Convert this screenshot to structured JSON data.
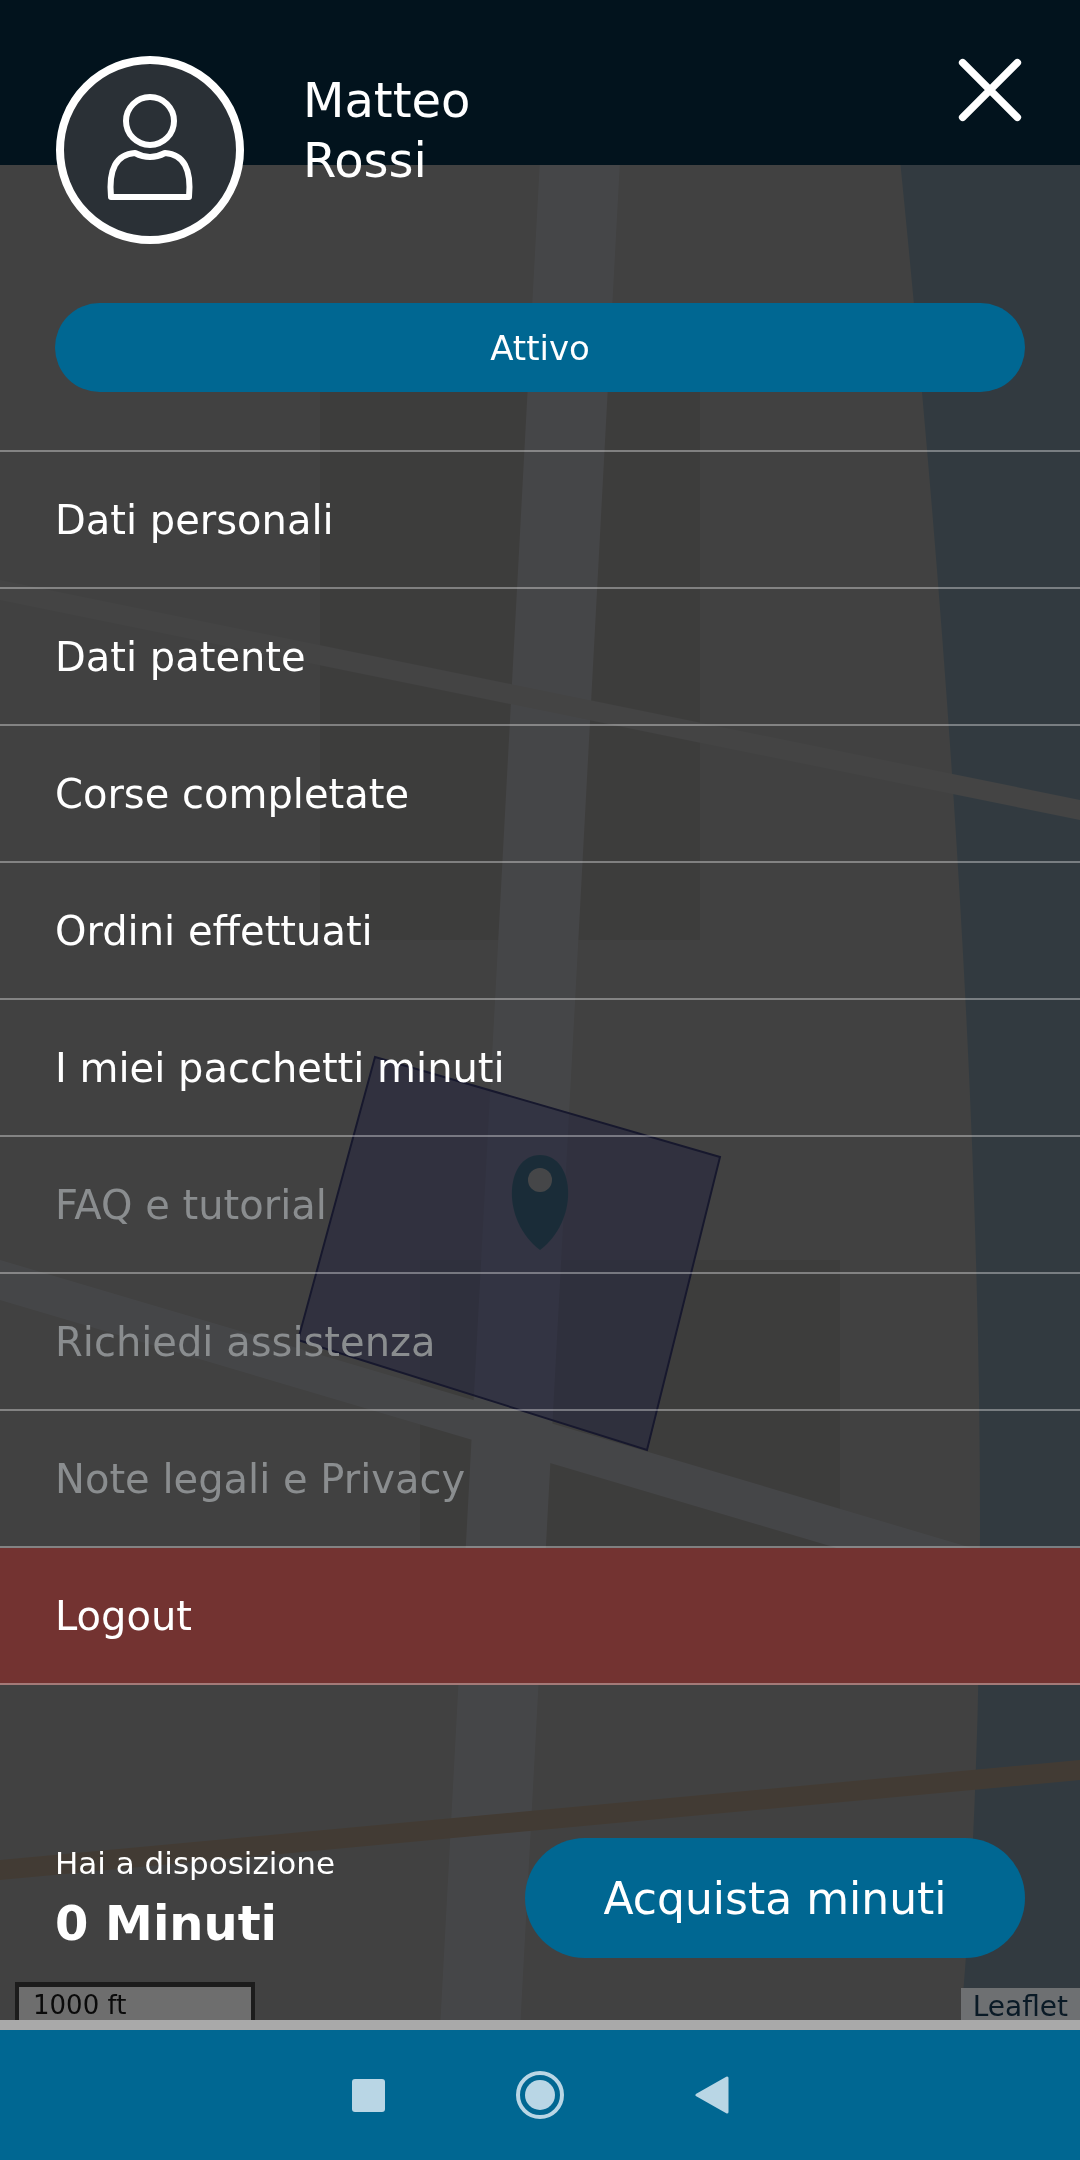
{
  "user": {
    "first_name": "Matteo",
    "last_name": "Rossi"
  },
  "status_button": "Attivo",
  "menu": [
    {
      "label": "Dati personali",
      "kind": "link",
      "disabled": false
    },
    {
      "label": "Dati patente",
      "kind": "link",
      "disabled": false
    },
    {
      "label": "Corse completate",
      "kind": "link",
      "disabled": false
    },
    {
      "label": "Ordini effettuati",
      "kind": "link",
      "disabled": false
    },
    {
      "label": "I miei pacchetti minuti",
      "kind": "link",
      "disabled": false
    },
    {
      "label": "FAQ e tutorial",
      "kind": "link",
      "disabled": true
    },
    {
      "label": "Richiedi assistenza",
      "kind": "link",
      "disabled": true
    },
    {
      "label": "Note legali e Privacy",
      "kind": "link",
      "disabled": true
    },
    {
      "label": "Logout",
      "kind": "danger",
      "disabled": false
    }
  ],
  "balance": {
    "caption": "Hai a disposizione",
    "amount": "0 Minuti"
  },
  "buy_button": "Acquista minuti",
  "map": {
    "kind": "picture",
    "scale": "1000 ft",
    "attribution": "Leaflet"
  }
}
